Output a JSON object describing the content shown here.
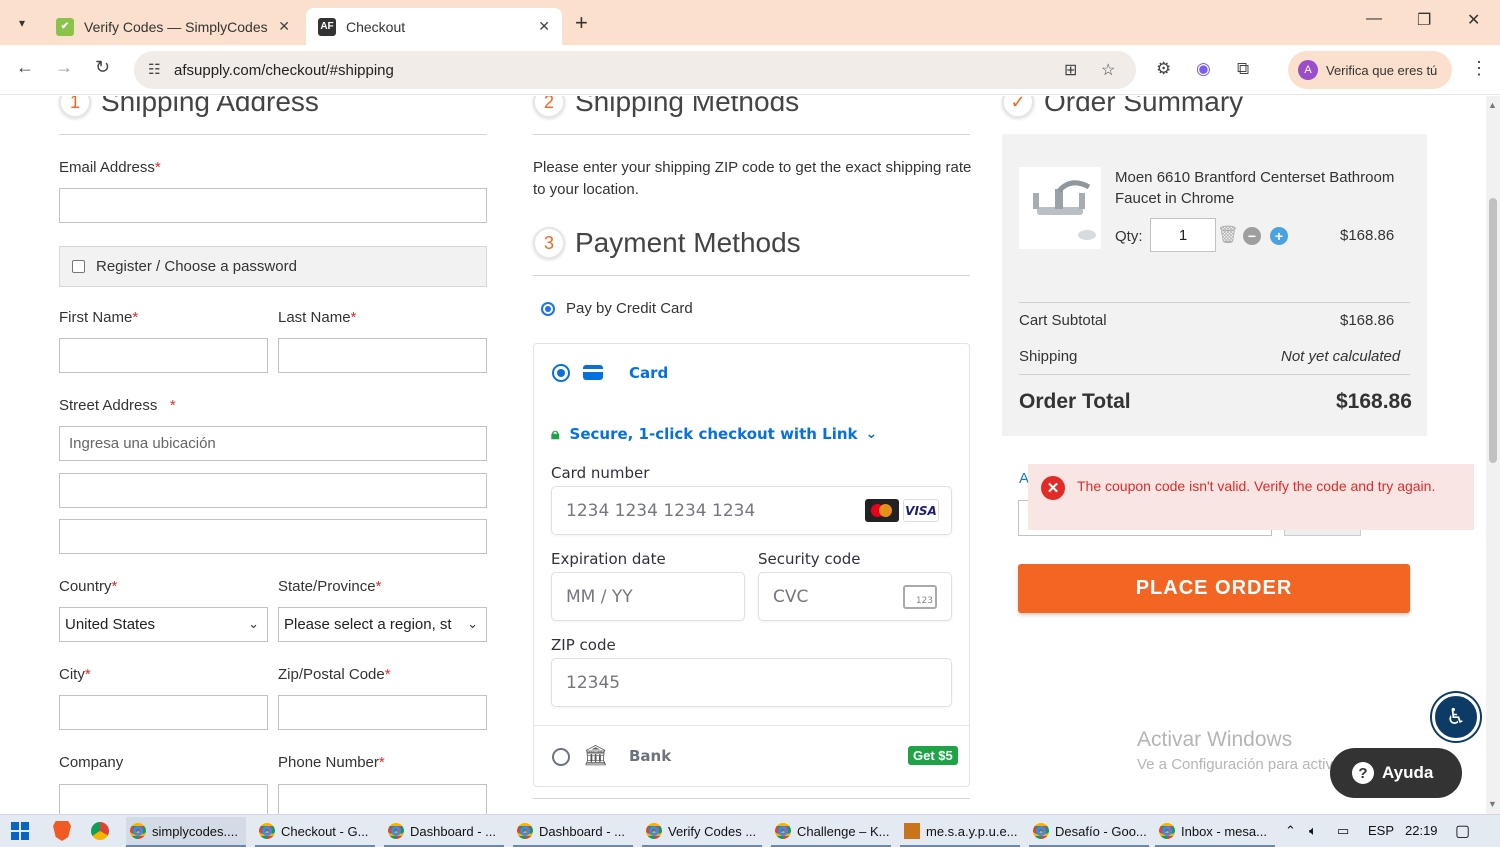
{
  "browser": {
    "tabs": [
      {
        "title": "Verify Codes — SimplyCodes",
        "active": false
      },
      {
        "title": "Checkout",
        "active": true
      }
    ],
    "url": "afsupply.com/checkout/#shipping",
    "profile_label": "Verifica que eres tú",
    "profile_initial": "A"
  },
  "shipping": {
    "step": "1",
    "heading": "Shipping Address",
    "email_label": "Email Address",
    "register_label": "Register / Choose a password",
    "first_name_label": "First Name",
    "last_name_label": "Last Name",
    "street_label": "Street Address",
    "street_placeholder": "Ingresa una ubicación",
    "country_label": "Country",
    "country_value": "United States",
    "state_label": "State/Province",
    "state_value": "Please select a region, st",
    "city_label": "City",
    "zip_label": "Zip/Postal Code",
    "company_label": "Company",
    "phone_label": "Phone Number",
    "required_mark": "*"
  },
  "methods": {
    "step": "2",
    "heading": "Shipping Methods",
    "intro": "Please enter your shipping ZIP code to get the exact shipping rate to your location."
  },
  "payment": {
    "step": "3",
    "heading": "Payment Methods",
    "option_label": "Pay by Credit Card",
    "card_tab": "Card",
    "link_text": "Secure, 1-click checkout with Link",
    "card_number_label": "Card number",
    "card_number_placeholder": "1234 1234 1234 1234",
    "visa": "VISA",
    "expiry_label": "Expiration date",
    "expiry_placeholder": "MM / YY",
    "cvc_label": "Security code",
    "cvc_placeholder": "CVC",
    "cvc_icon_text": "123",
    "zip_label": "ZIP code",
    "zip_placeholder": "12345",
    "bank_tab": "Bank",
    "bank_badge": "Get $5"
  },
  "summary": {
    "heading": "Order Summary",
    "product_name": "Moen 6610 Brantford Centerset Bathroom Faucet in Chrome",
    "qty_label": "Qty:",
    "qty_value": "1",
    "item_price": "$168.86",
    "subtotal_label": "Cart Subtotal",
    "subtotal_value": "$168.86",
    "shipping_label": "Shipping",
    "shipping_value": "Not yet calculated",
    "total_label": "Order Total",
    "total_value": "$168.86",
    "coupon_partial": "A",
    "error_message": "The coupon code isn't valid. Verify the code and try again.",
    "place_order": "PLACE ORDER"
  },
  "overlays": {
    "watermark_title": "Activar Windows",
    "watermark_sub": "Ve a Configuración para activar Windows.",
    "help_label": "Ayuda"
  },
  "taskbar": {
    "items": [
      "simplycodes....",
      "Checkout - G...",
      "Dashboard - ...",
      "Dashboard - ...",
      "Verify Codes ...",
      "Challenge – K...",
      "me.s.a.y.p.u.e...",
      "Desafío - Goo...",
      "Inbox - mesa..."
    ],
    "lang": "ESP",
    "time": "22:19"
  },
  "colors": {
    "accent": "#f26522",
    "stripe_blue": "#0570de",
    "error": "#e02b27",
    "tab_strip": "#fbe1cd"
  }
}
